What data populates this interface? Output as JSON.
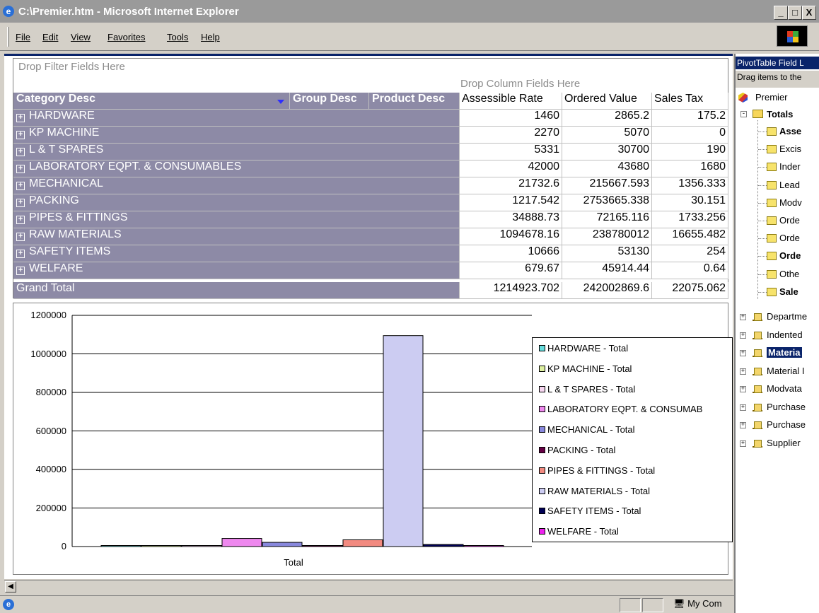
{
  "window": {
    "title": "C:\\Premier.htm - Microsoft Internet Explorer",
    "buttons": [
      "_",
      "&#9744;",
      "X"
    ]
  },
  "menu": [
    "File",
    "Edit",
    "View",
    "Favorites",
    "Tools",
    "Help"
  ],
  "pivot": {
    "filter_placeholder": "Drop Filter Fields Here",
    "column_placeholder": "Drop Column Fields Here",
    "row_headers": [
      "Category Desc",
      "Group Desc",
      "Product Desc"
    ],
    "value_headers": [
      "Assessible Rate",
      "Ordered Value",
      "Sales Tax"
    ],
    "rows": [
      {
        "label": "HARDWARE",
        "values": [
          "1460",
          "2865.2",
          "175.2"
        ]
      },
      {
        "label": "KP MACHINE",
        "values": [
          "2270",
          "5070",
          "0"
        ]
      },
      {
        "label": "L & T SPARES",
        "values": [
          "5331",
          "30700",
          "190"
        ]
      },
      {
        "label": "LABORATORY EQPT. & CONSUMABLES",
        "values": [
          "42000",
          "43680",
          "1680"
        ]
      },
      {
        "label": "MECHANICAL",
        "values": [
          "21732.6",
          "215667.593",
          "1356.333"
        ]
      },
      {
        "label": "PACKING",
        "values": [
          "1217.542",
          "2753665.338",
          "30.151"
        ]
      },
      {
        "label": "PIPES & FITTINGS",
        "values": [
          "34888.73",
          "72165.116",
          "1733.256"
        ]
      },
      {
        "label": "RAW MATERIALS",
        "values": [
          "1094678.16",
          "238780012",
          "16655.482"
        ]
      },
      {
        "label": "SAFETY ITEMS",
        "values": [
          "10666",
          "53130",
          "254"
        ]
      },
      {
        "label": "WELFARE",
        "values": [
          "679.67",
          "45914.44",
          "0.64"
        ]
      }
    ],
    "grand_total_label": "Grand Total",
    "grand_total_values": [
      "1214923.702",
      "242002869.6",
      "22075.062"
    ]
  },
  "chart_data": {
    "type": "bar",
    "categories": [
      "Total"
    ],
    "ylim": [
      0,
      1200000
    ],
    "yticks": [
      "1200000",
      "1000000",
      "800000",
      "600000",
      "400000",
      "200000",
      "0"
    ],
    "series": [
      {
        "name": "HARDWARE - Total",
        "values": [
          1460
        ],
        "color": "#66dddd"
      },
      {
        "name": "KP MACHINE - Total",
        "values": [
          2270
        ],
        "color": "#ddf0a0"
      },
      {
        "name": "L & T SPARES - Total",
        "values": [
          5331
        ],
        "color": "#f6d6f0"
      },
      {
        "name": "LABORATORY EQPT. & CONSUMAB",
        "values": [
          42000
        ],
        "color": "#ee88ee"
      },
      {
        "name": "MECHANICAL - Total",
        "values": [
          21732.6
        ],
        "color": "#8888dd"
      },
      {
        "name": "PACKING - Total",
        "values": [
          1217.542
        ],
        "color": "#660044"
      },
      {
        "name": "PIPES & FITTINGS - Total",
        "values": [
          34888.73
        ],
        "color": "#f28a80"
      },
      {
        "name": "RAW MATERIALS - Total",
        "values": [
          1094678.16
        ],
        "color": "#ccccf2"
      },
      {
        "name": "SAFETY ITEMS - Total",
        "values": [
          10666
        ],
        "color": "#000055"
      },
      {
        "name": "WELFARE - Total",
        "values": [
          679.67
        ],
        "color": "#ee22ee"
      }
    ]
  },
  "status": {
    "zone": "My Com"
  },
  "field_list": {
    "title": "PivotTable Field L",
    "hint": "Drag items to the",
    "root": "Premier",
    "totals": "Totals",
    "total_items": [
      {
        "label": "Asse",
        "bold": true
      },
      {
        "label": "Excis",
        "bold": false
      },
      {
        "label": "Inder",
        "bold": false
      },
      {
        "label": "Lead",
        "bold": false
      },
      {
        "label": "Modv",
        "bold": false
      },
      {
        "label": "Orde",
        "bold": false
      },
      {
        "label": "Orde",
        "bold": false
      },
      {
        "label": "Orde",
        "bold": true
      },
      {
        "label": "Othe",
        "bold": false
      },
      {
        "label": "Sale",
        "bold": true
      }
    ],
    "dimensions": [
      {
        "label": "Departme",
        "selected": false
      },
      {
        "label": "Indented",
        "selected": false
      },
      {
        "label": "Materia",
        "selected": true
      },
      {
        "label": "Material I",
        "selected": false
      },
      {
        "label": "Modvata",
        "selected": false
      },
      {
        "label": "Purchase",
        "selected": false
      },
      {
        "label": "Purchase",
        "selected": false
      },
      {
        "label": "Supplier",
        "selected": false
      }
    ]
  }
}
